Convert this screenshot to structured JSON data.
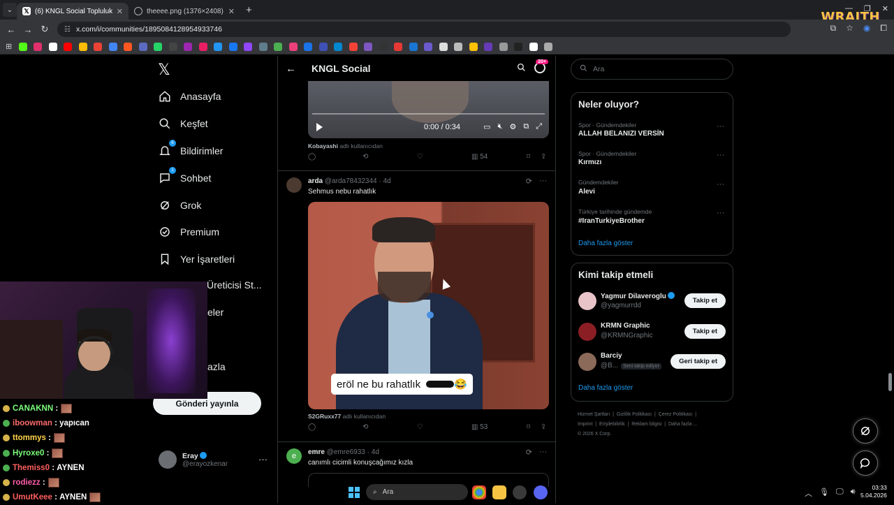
{
  "browser": {
    "tabs": [
      {
        "title": "(6) KNGL Social Topluluk / X",
        "active": true
      },
      {
        "title": "theeee.png (1376×2408)",
        "active": false
      }
    ],
    "url": "x.com/i/communities/1895084128954933746",
    "overlay_brand": "WRAITH"
  },
  "x_nav": {
    "items": [
      {
        "label": "Anasayfa",
        "icon": "home-icon"
      },
      {
        "label": "Keşfet",
        "icon": "search-icon"
      },
      {
        "label": "Bildirimler",
        "icon": "bell-icon",
        "badge": "6"
      },
      {
        "label": "Sohbet",
        "icon": "chat-icon",
        "badge": "1"
      },
      {
        "label": "Grok",
        "icon": "grok-icon"
      },
      {
        "label": "Premium",
        "icon": "premium-icon"
      },
      {
        "label": "Yer İşaretleri",
        "icon": "bookmark-icon"
      },
      {
        "label": "Üreticisi St...",
        "icon": "creator-icon"
      },
      {
        "label": "eler",
        "icon": "list-icon"
      },
      {
        "label": "azla",
        "icon": "more-icon"
      }
    ],
    "post_button": "Gönderi yayınla",
    "account": {
      "name": "Eray",
      "handle": "@erayozkenar",
      "more": "···"
    }
  },
  "main": {
    "header_title": "KNGL Social",
    "header_badge": "20+",
    "video": {
      "time": "0:00 / 0:34"
    },
    "post1_footer": {
      "source_user": "Kobayashi",
      "source_suffix": "adlı kullanıcıdan",
      "views": "54"
    },
    "post2": {
      "name": "arda",
      "handle": "@arda78432344",
      "age": "4d",
      "text": "Sehmus nebu rahatlık",
      "caption": "eröl ne bu rahatlık",
      "caption_emoji": "😂",
      "source_user": "S2GRuxx77",
      "source_suffix": "adlı kullanıcıdan",
      "views": "53"
    },
    "post3": {
      "name": "emre",
      "handle": "@emre6933",
      "age": "4d",
      "text": "canımlı cicimli konuşcağımız kızla",
      "avatar_letter": "e"
    }
  },
  "right": {
    "search_placeholder": "Ara",
    "trends_title": "Neler oluyor?",
    "trends": [
      {
        "meta": "Spor · Gündemdekiler",
        "name": "ALLAH BELANIZI VERSİN"
      },
      {
        "meta": "Spor · Gündemdekiler",
        "name": "Kırmızı"
      },
      {
        "meta": "Gündemdekiler",
        "name": "Alevi"
      },
      {
        "meta": "Türkiye tarihinde gündemde",
        "name": "#IranTurkiyeBrother"
      }
    ],
    "trends_more": "Daha fazla göster",
    "who_title": "Kimi takip etmeli",
    "who": [
      {
        "name": "Yagmur Dilaveroglu",
        "handle": "@yagmurrdd",
        "button": "Takip et",
        "verified": true
      },
      {
        "name": "KRMN Graphic",
        "handle": "@KRMNGraphic",
        "button": "Takip et",
        "verified": false
      },
      {
        "name": "Barciy",
        "handle": "@B...",
        "follows_you": "Seni takip ediyor",
        "button": "Geri takip et",
        "verified": false
      }
    ],
    "who_more": "Daha fazla göster",
    "footer": [
      "Hizmet Şartları",
      "Gizlilik Politikası",
      "Çerez Politikası",
      "Imprint",
      "Erişilebilirlik",
      "Reklam bilgisi",
      "Daha fazla ...",
      "© 2026 X Corp."
    ]
  },
  "chat": [
    {
      "user": "CANAKNN",
      "color": "#7cfc7c",
      "msg": "",
      "emote": true
    },
    {
      "user": "iboowman",
      "color": "#ff6b6b",
      "msg": "yapıcan",
      "emote": false
    },
    {
      "user": "ttommys",
      "color": "#ffd24a",
      "msg": "",
      "emote": true
    },
    {
      "user": "Hyroxe0",
      "color": "#7cfc7c",
      "msg": "",
      "emote": true
    },
    {
      "user": "Themiss0",
      "color": "#ff5f5f",
      "msg": "AYNEN",
      "emote": false
    },
    {
      "user": "rodiezz",
      "color": "#ff5fa8",
      "msg": "",
      "emote": true
    },
    {
      "user": "UmutKeee",
      "color": "#ff5f5f",
      "msg": "AYNEN",
      "emote": true
    }
  ],
  "taskbar": {
    "search_placeholder": "Ara",
    "time": "03:33",
    "date": "5.04.2026"
  }
}
